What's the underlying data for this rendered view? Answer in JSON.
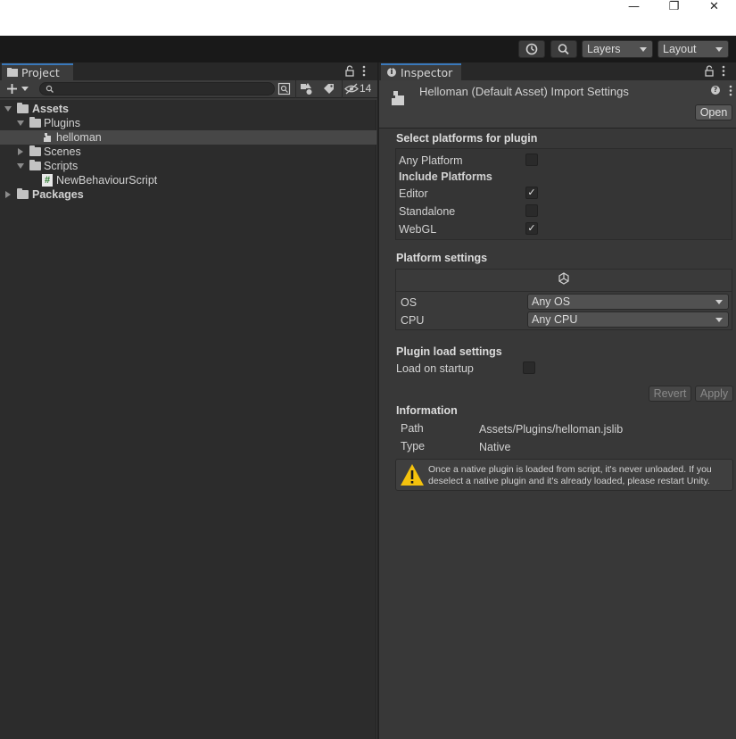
{
  "window": {
    "minimize_glyph": "—",
    "restore_glyph": "❐",
    "close_glyph": "✕"
  },
  "toolbar": {
    "history_icon": "history-icon",
    "search_icon": "search-icon",
    "layers_label": "Layers",
    "layout_label": "Layout"
  },
  "project": {
    "tab_label": "Project",
    "search_placeholder": "",
    "hidden_count": "14",
    "tree": [
      {
        "label": "Assets",
        "depth": 0,
        "expanded": true,
        "type": "folder",
        "bold": true
      },
      {
        "label": "Plugins",
        "depth": 1,
        "expanded": true,
        "type": "folder",
        "bold": false
      },
      {
        "label": "helloman",
        "depth": 2,
        "type": "plugin",
        "selected": true
      },
      {
        "label": "Scenes",
        "depth": 1,
        "expanded": false,
        "type": "folder",
        "bold": false
      },
      {
        "label": "Scripts",
        "depth": 1,
        "expanded": true,
        "type": "folder",
        "bold": false
      },
      {
        "label": "NewBehaviourScript",
        "depth": 2,
        "type": "script"
      },
      {
        "label": "Packages",
        "depth": 0,
        "expanded": false,
        "type": "folder",
        "bold": true
      }
    ]
  },
  "inspector": {
    "tab_label": "Inspector",
    "title": "Helloman (Default Asset) Import Settings",
    "open_button": "Open",
    "select_platforms_title": "Select platforms for plugin",
    "any_platform_label": "Any Platform",
    "any_platform_checked": false,
    "include_platforms_label": "Include Platforms",
    "platforms": [
      {
        "label": "Editor",
        "checked": true
      },
      {
        "label": "Standalone",
        "checked": false
      },
      {
        "label": "WebGL",
        "checked": true
      }
    ],
    "platform_settings_title": "Platform settings",
    "os_label": "OS",
    "os_value": "Any OS",
    "cpu_label": "CPU",
    "cpu_value": "Any CPU",
    "plugin_load_title": "Plugin load settings",
    "load_on_startup_label": "Load on startup",
    "load_on_startup_checked": false,
    "revert_button": "Revert",
    "apply_button": "Apply",
    "information_title": "Information",
    "path_label": "Path",
    "path_value": "Assets/Plugins/helloman.jslib",
    "type_label": "Type",
    "type_value": "Native",
    "warning_line1": "Once a native plugin is loaded from script, it's never unloaded. If you",
    "warning_line2": "deselect a native plugin and it's already loaded, please restart Unity."
  },
  "colors": {
    "accent": "#3a79bb",
    "warning": "#f4c20d",
    "script_icon": "#4caf50"
  }
}
